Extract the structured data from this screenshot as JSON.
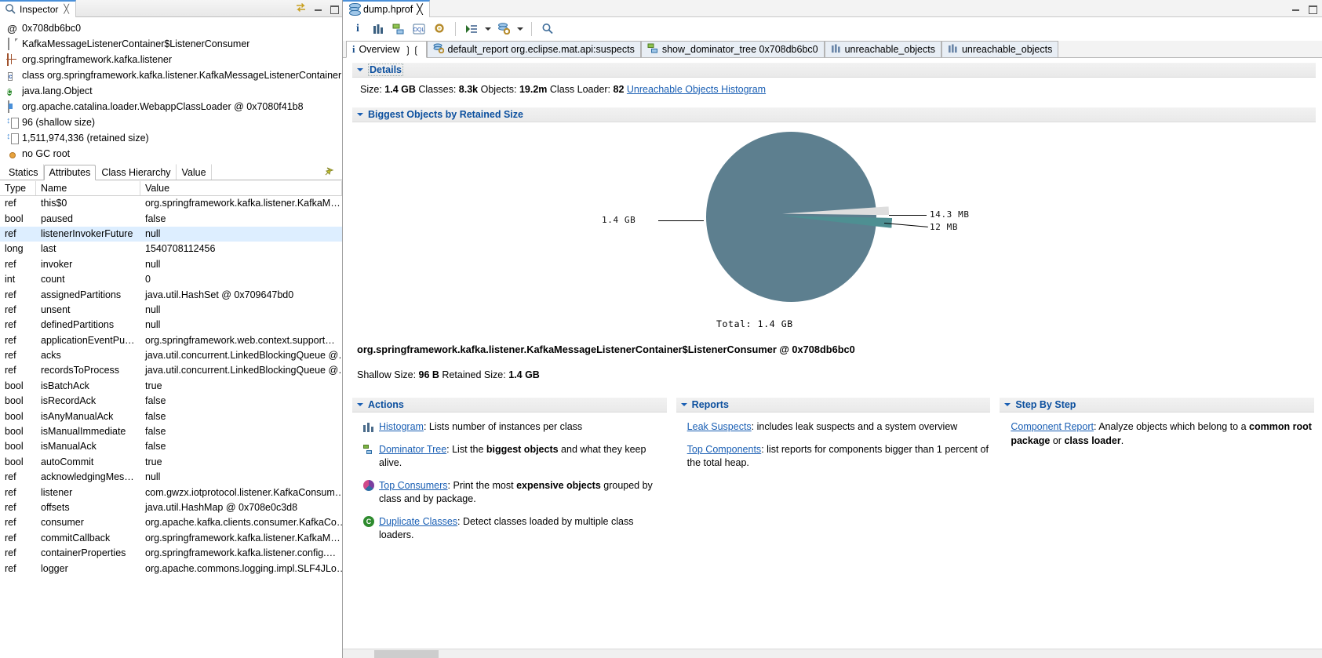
{
  "inspector": {
    "title": "Inspector",
    "close_label": "╳",
    "rows": [
      {
        "icon": "at-icon",
        "text": "0x708db6bc0"
      },
      {
        "icon": "document-icon",
        "text": "KafkaMessageListenerContainer$ListenerConsumer"
      },
      {
        "icon": "package-icon",
        "text": "org.springframework.kafka.listener"
      },
      {
        "icon": "class-icon",
        "text": "class org.springframework.kafka.listener.KafkaMessageListenerContainer…"
      },
      {
        "icon": "object-icon",
        "text": "java.lang.Object"
      },
      {
        "icon": "classloader-icon",
        "text": "org.apache.catalina.loader.WebappClassLoader @ 0x7080f41b8"
      },
      {
        "icon": "size-icon",
        "text": "96 (shallow size)"
      },
      {
        "icon": "size-icon",
        "text": "1,511,974,336 (retained size)"
      },
      {
        "icon": "gcroot-icon",
        "text": "no GC root"
      }
    ],
    "tabs": [
      {
        "label": "Statics",
        "active": false
      },
      {
        "label": "Attributes",
        "active": true
      },
      {
        "label": "Class Hierarchy",
        "active": false
      },
      {
        "label": "Value",
        "active": false
      }
    ],
    "table": {
      "columns": [
        "Type",
        "Name",
        "Value"
      ],
      "rows": [
        {
          "type": "ref",
          "name": "this$0",
          "value": "org.springframework.kafka.listener.KafkaM…",
          "selected": false
        },
        {
          "type": "bool",
          "name": "paused",
          "value": "false",
          "selected": false
        },
        {
          "type": "ref",
          "name": "listenerInvokerFuture",
          "value": "null",
          "selected": true
        },
        {
          "type": "long",
          "name": "last",
          "value": "1540708112456",
          "selected": false
        },
        {
          "type": "ref",
          "name": "invoker",
          "value": "null",
          "selected": false
        },
        {
          "type": "int",
          "name": "count",
          "value": "0",
          "selected": false
        },
        {
          "type": "ref",
          "name": "assignedPartitions",
          "value": "java.util.HashSet @ 0x709647bd0",
          "selected": false
        },
        {
          "type": "ref",
          "name": "unsent",
          "value": "null",
          "selected": false
        },
        {
          "type": "ref",
          "name": "definedPartitions",
          "value": "null",
          "selected": false
        },
        {
          "type": "ref",
          "name": "applicationEventPu…",
          "value": "org.springframework.web.context.support…",
          "selected": false
        },
        {
          "type": "ref",
          "name": "acks",
          "value": "java.util.concurrent.LinkedBlockingQueue @…",
          "selected": false
        },
        {
          "type": "ref",
          "name": "recordsToProcess",
          "value": "java.util.concurrent.LinkedBlockingQueue @…",
          "selected": false
        },
        {
          "type": "bool",
          "name": "isBatchAck",
          "value": "true",
          "selected": false
        },
        {
          "type": "bool",
          "name": "isRecordAck",
          "value": "false",
          "selected": false
        },
        {
          "type": "bool",
          "name": "isAnyManualAck",
          "value": "false",
          "selected": false
        },
        {
          "type": "bool",
          "name": "isManualImmediate",
          "value": "false",
          "selected": false
        },
        {
          "type": "bool",
          "name": "isManualAck",
          "value": "false",
          "selected": false
        },
        {
          "type": "bool",
          "name": "autoCommit",
          "value": "true",
          "selected": false
        },
        {
          "type": "ref",
          "name": "acknowledgingMes…",
          "value": "null",
          "selected": false
        },
        {
          "type": "ref",
          "name": "listener",
          "value": "com.gwzx.iotprotocol.listener.KafkaConsum…",
          "selected": false
        },
        {
          "type": "ref",
          "name": "offsets",
          "value": "java.util.HashMap @ 0x708e0c3d8",
          "selected": false
        },
        {
          "type": "ref",
          "name": "consumer",
          "value": "org.apache.kafka.clients.consumer.KafkaCo…",
          "selected": false
        },
        {
          "type": "ref",
          "name": "commitCallback",
          "value": "org.springframework.kafka.listener.KafkaM…",
          "selected": false
        },
        {
          "type": "ref",
          "name": "containerProperties",
          "value": "org.springframework.kafka.listener.config.…",
          "selected": false
        },
        {
          "type": "ref",
          "name": "logger",
          "value": "org.apache.commons.logging.impl.SLF4JLo…",
          "selected": false
        }
      ]
    }
  },
  "editor": {
    "tab": {
      "label": "dump.hprof",
      "close_label": "╳"
    },
    "toolbar": [
      {
        "name": "info-icon",
        "glyph": "i"
      },
      {
        "name": "histogram-icon",
        "glyph": ""
      },
      {
        "name": "dominator-tree-icon",
        "glyph": ""
      },
      {
        "name": "oql-icon",
        "glyph": "OQL"
      },
      {
        "name": "query-browser-icon",
        "glyph": ""
      },
      {
        "name": "run-expert-system-icon",
        "glyph": ""
      },
      {
        "name": "open-query-icon",
        "glyph": ""
      },
      {
        "name": "search-icon",
        "glyph": "⚲"
      }
    ],
    "inner_tabs": [
      {
        "label": "Overview",
        "icon": "info-icon",
        "active": true,
        "closable": true
      },
      {
        "label": "default_report  org.eclipse.mat.api:suspects",
        "icon": "report-icon",
        "active": false,
        "closable": false
      },
      {
        "label": "show_dominator_tree 0x708db6bc0",
        "icon": "dominator-tree-icon",
        "active": false,
        "closable": false
      },
      {
        "label": "unreachable_objects",
        "icon": "histogram-icon",
        "active": false,
        "closable": false
      },
      {
        "label": "unreachable_objects",
        "icon": "histogram-icon",
        "active": false,
        "closable": false
      }
    ]
  },
  "overview": {
    "details": {
      "title": "Details",
      "size_label": "Size:",
      "size_value": "1.4 GB",
      "classes_label": "Classes:",
      "classes_value": "8.3k",
      "objects_label": "Objects:",
      "objects_value": "19.2m",
      "loader_label": "Class Loader:",
      "loader_value": "82",
      "link": "Unreachable Objects Histogram"
    },
    "biggest": {
      "title": "Biggest Objects by Retained Size"
    },
    "selected_object": {
      "name": "org.springframework.kafka.listener.KafkaMessageListenerContainer$ListenerConsumer @ 0x708db6bc0",
      "shallow_label": "Shallow Size:",
      "shallow_value": "96 B",
      "retained_label": "Retained Size:",
      "retained_value": "1.4 GB"
    },
    "actions": {
      "title": "Actions",
      "items": [
        {
          "icon": "histogram-icon",
          "link": "Histogram",
          "rest_pre": ": Lists number of instances per class",
          "bold": "",
          "rest_post": ""
        },
        {
          "icon": "dominator-tree-icon",
          "link": "Dominator Tree",
          "rest_pre": ": List the ",
          "bold": "biggest objects",
          "rest_post": " and what they keep alive."
        },
        {
          "icon": "top-consumers-icon",
          "link": "Top Consumers",
          "rest_pre": ": Print the most ",
          "bold": "expensive objects",
          "rest_post": " grouped by class and by package."
        },
        {
          "icon": "duplicate-classes-icon",
          "link": "Duplicate Classes",
          "rest_pre": ": Detect classes loaded by multiple class loaders.",
          "bold": "",
          "rest_post": ""
        }
      ]
    },
    "reports": {
      "title": "Reports",
      "items": [
        {
          "icon": "",
          "link": "Leak Suspects",
          "rest_pre": ": includes leak suspects and a system overview",
          "bold": "",
          "rest_post": ""
        },
        {
          "icon": "",
          "link": "Top Components",
          "rest_pre": ": list reports for components bigger than 1 percent of the total heap.",
          "bold": "",
          "rest_post": ""
        }
      ]
    },
    "step_by_step": {
      "title": "Step By Step",
      "items": [
        {
          "icon": "",
          "link": "Component Report",
          "rest_pre": ": Analyze objects which belong to a ",
          "bold": "common root package",
          "mid": " or ",
          "bold2": "class loader",
          "rest_post": "."
        }
      ]
    }
  },
  "chart_data": {
    "type": "pie",
    "title": "Biggest Objects by Retained Size",
    "total_label": "Total: 1.4 GB",
    "total_value_bytes": 1511974336,
    "labels": [
      "1.4 GB",
      "14.3 MB",
      "12 MB"
    ],
    "values": [
      1511974336,
      14300000,
      12000000
    ],
    "colors": [
      "#5d7f8f",
      "#dedede",
      "#4e8f92"
    ],
    "legend": "none",
    "annotations": [
      "1.4 GB",
      "14.3 MB",
      "12 MB",
      "Total: 1.4 GB"
    ]
  },
  "colors": {
    "accent_blue": "#1a5fb4",
    "tab_active_border": "#4a90d9",
    "selection": "#ddeeff",
    "pie_main": "#5d7f8f",
    "pie_teal": "#4e8f92",
    "pie_light": "#dedede"
  }
}
